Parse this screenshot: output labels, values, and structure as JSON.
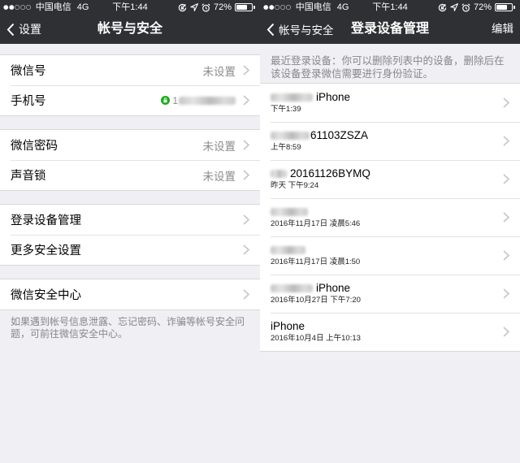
{
  "status_bar": {
    "signal": "●●○○○",
    "carrier": "中国电信",
    "network": "4G",
    "time": "下午1:44",
    "battery": "72%",
    "battery_level": 0.72,
    "icons": [
      "rotation-lock-icon",
      "location-icon",
      "alarm-icon",
      "battery-icon"
    ]
  },
  "account_screen": {
    "nav": {
      "back_label": "设置",
      "title": "帐号与安全"
    },
    "groups": [
      {
        "rows": [
          {
            "label": "微信号",
            "value": "未设置"
          },
          {
            "label": "手机号",
            "value_prefix": "1",
            "icon": "lock-icon"
          }
        ]
      },
      {
        "rows": [
          {
            "label": "微信密码",
            "value": "未设置"
          },
          {
            "label": "声音锁",
            "value": "未设置"
          }
        ]
      },
      {
        "rows": [
          {
            "label": "登录设备管理"
          },
          {
            "label": "更多安全设置"
          }
        ]
      },
      {
        "rows": [
          {
            "label": "微信安全中心"
          }
        ]
      }
    ],
    "footer_note": "如果遇到帐号信息泄露、忘记密码、诈骗等帐号安全问题，可前往微信安全中心。"
  },
  "devices_screen": {
    "nav": {
      "back_label": "帐号与安全",
      "title": "登录设备管理",
      "action_label": "编辑"
    },
    "header_note": "最近登录设备：你可以删除列表中的设备，删除后在该设备登录微信需要进行身份验证。",
    "devices": [
      {
        "name": "iPhone",
        "time": "下午1:39"
      },
      {
        "name": "61103ZSZA",
        "time": "上午8:59"
      },
      {
        "name": "20161126BYMQ",
        "time": "昨天 下午9:24"
      },
      {
        "time": "2016年11月17日 凌晨5:46"
      },
      {
        "time": "2016年11月17日 凌晨1:50"
      },
      {
        "name": "iPhone",
        "time": "2016年10月27日 下午7:20"
      },
      {
        "name": "iPhone",
        "time": "2016年10月4日 上午10:13"
      }
    ]
  },
  "colors": {
    "nav_bar": "#2f3034",
    "background": "#efeff4",
    "secure_green": "#1aad19",
    "secondary_text": "#8c8c8c"
  }
}
